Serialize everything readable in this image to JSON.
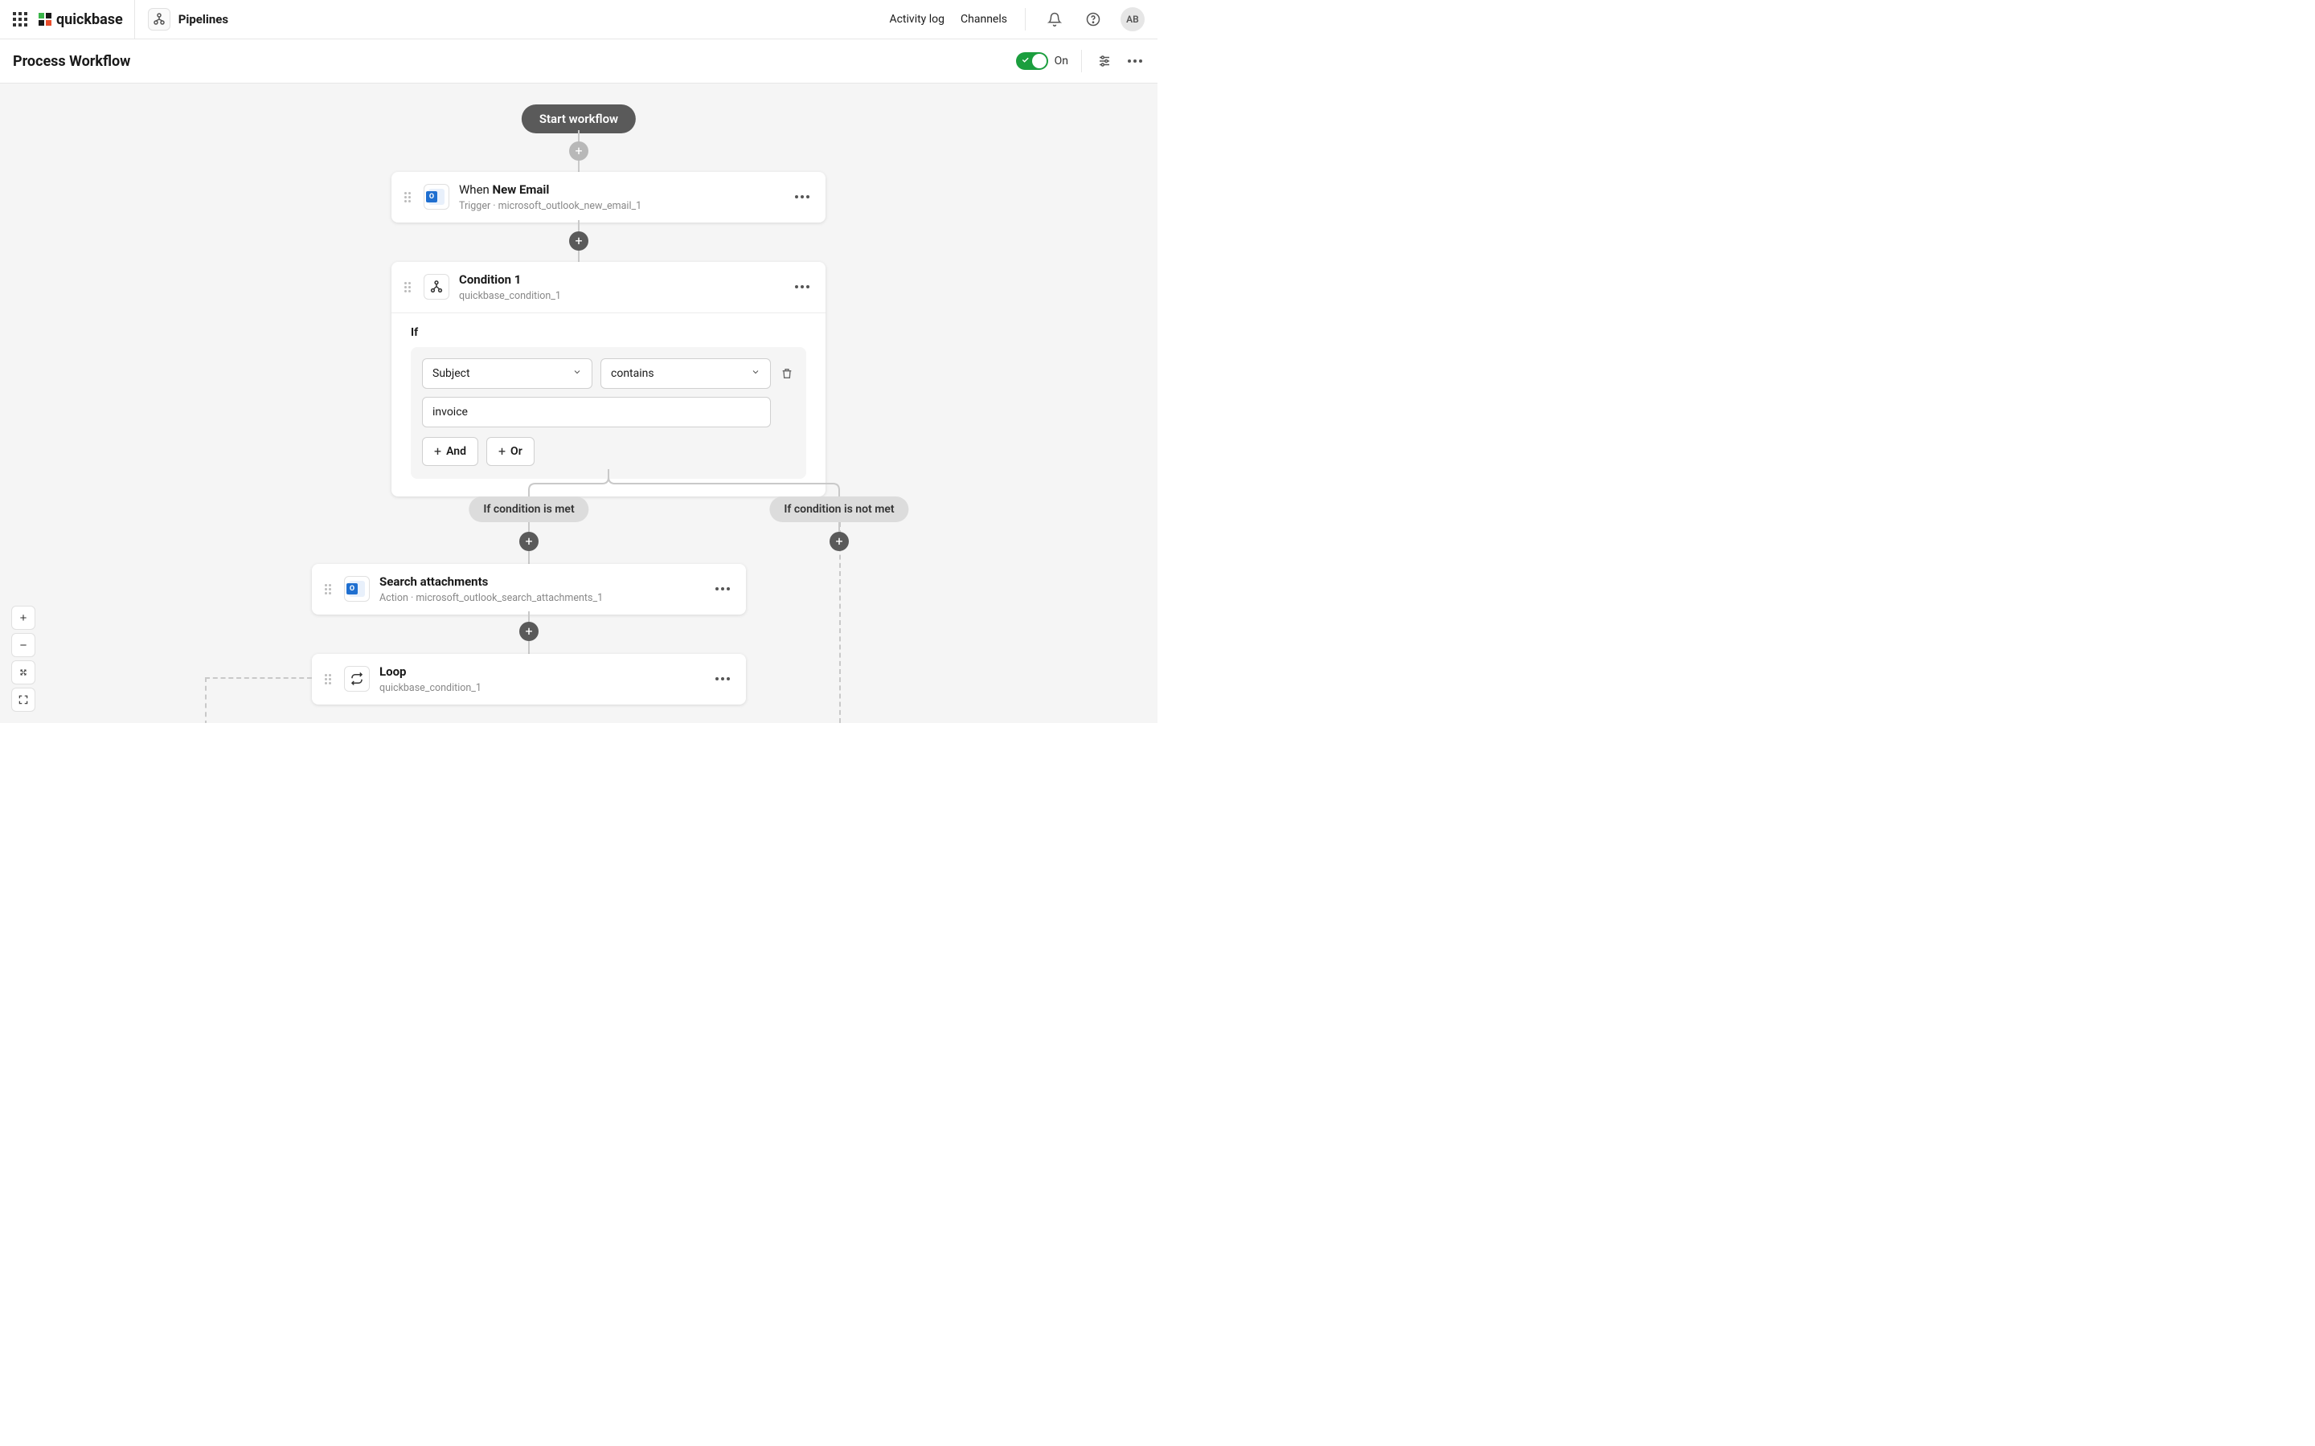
{
  "brand": "quickbase",
  "breadcrumb": "Pipelines",
  "topLinks": {
    "activity": "Activity log",
    "channels": "Channels"
  },
  "avatar": "AB",
  "page": {
    "title": "Process Workflow",
    "toggle": "On"
  },
  "workflow": {
    "start": "Start workflow",
    "trigger": {
      "prefix": "When ",
      "name": "New Email",
      "sub": "Trigger · microsoft_outlook_new_email_1"
    },
    "condition": {
      "title": "Condition 1",
      "sub": "quickbase_condition_1",
      "ifLabel": "If",
      "field": "Subject",
      "op": "contains",
      "value": "invoice",
      "andLabel": "And",
      "orLabel": "Or"
    },
    "branches": {
      "met": "If condition is met",
      "notmet": "If condition is not met"
    },
    "search": {
      "title": "Search attachments",
      "sub": "Action · microsoft_outlook_search_attachments_1"
    },
    "loop": {
      "title": "Loop",
      "sub": "quickbase_condition_1"
    }
  }
}
